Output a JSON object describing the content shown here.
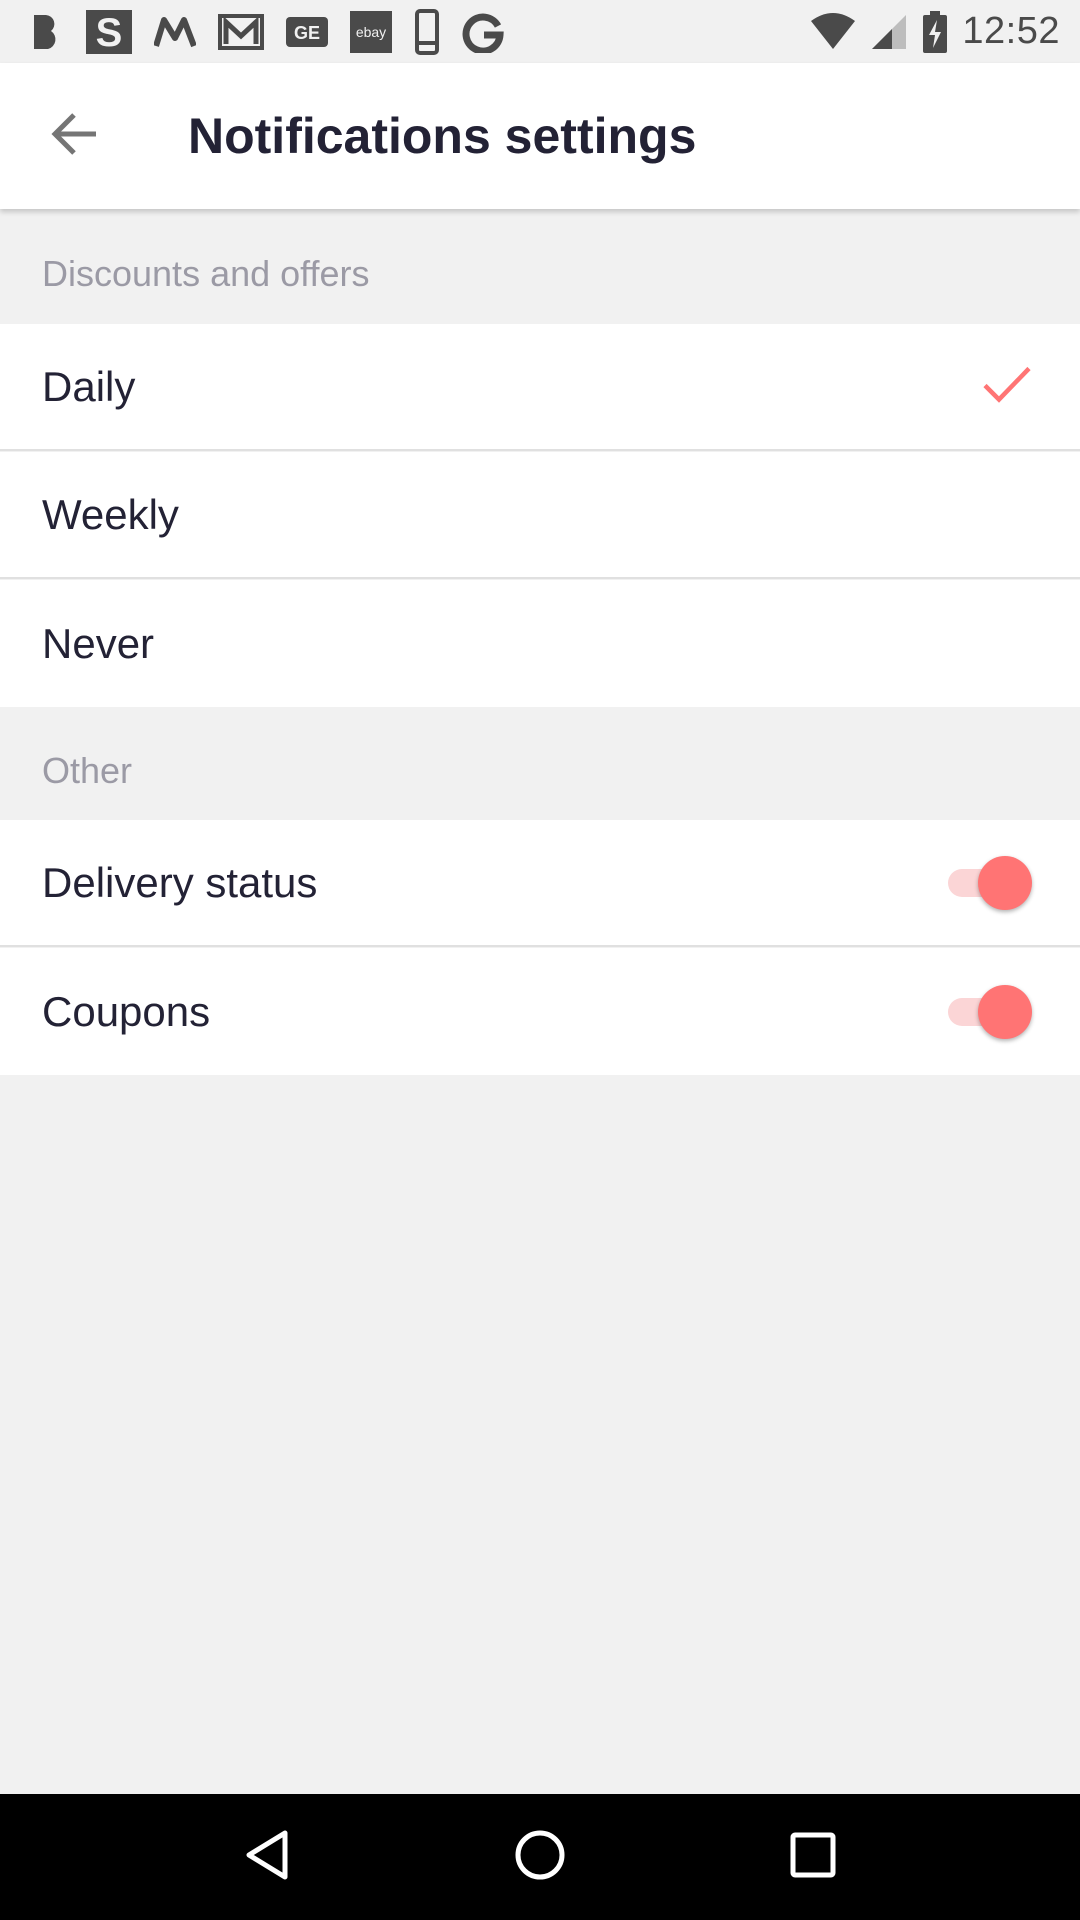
{
  "status_bar": {
    "time": "12:52",
    "notification_icons": [
      "b-app-icon",
      "s-app-icon",
      "m-app-icon",
      "gmail-icon",
      "ge-app-icon",
      "ebay-icon",
      "phone-icon",
      "google-icon"
    ],
    "ebay_label": "ebay"
  },
  "header": {
    "title": "Notifications settings"
  },
  "sections": {
    "discounts": {
      "title": "Discounts and offers",
      "options": [
        {
          "label": "Daily",
          "selected": true
        },
        {
          "label": "Weekly",
          "selected": false
        },
        {
          "label": "Never",
          "selected": false
        }
      ]
    },
    "other": {
      "title": "Other",
      "toggles": [
        {
          "label": "Delivery status",
          "on": true
        },
        {
          "label": "Coupons",
          "on": true
        }
      ]
    }
  },
  "colors": {
    "accent": "#ff7474",
    "accent_light": "#fbd5d6",
    "text_primary": "#232235",
    "text_secondary": "#9b9aa5",
    "background": "#f1f1f1"
  }
}
